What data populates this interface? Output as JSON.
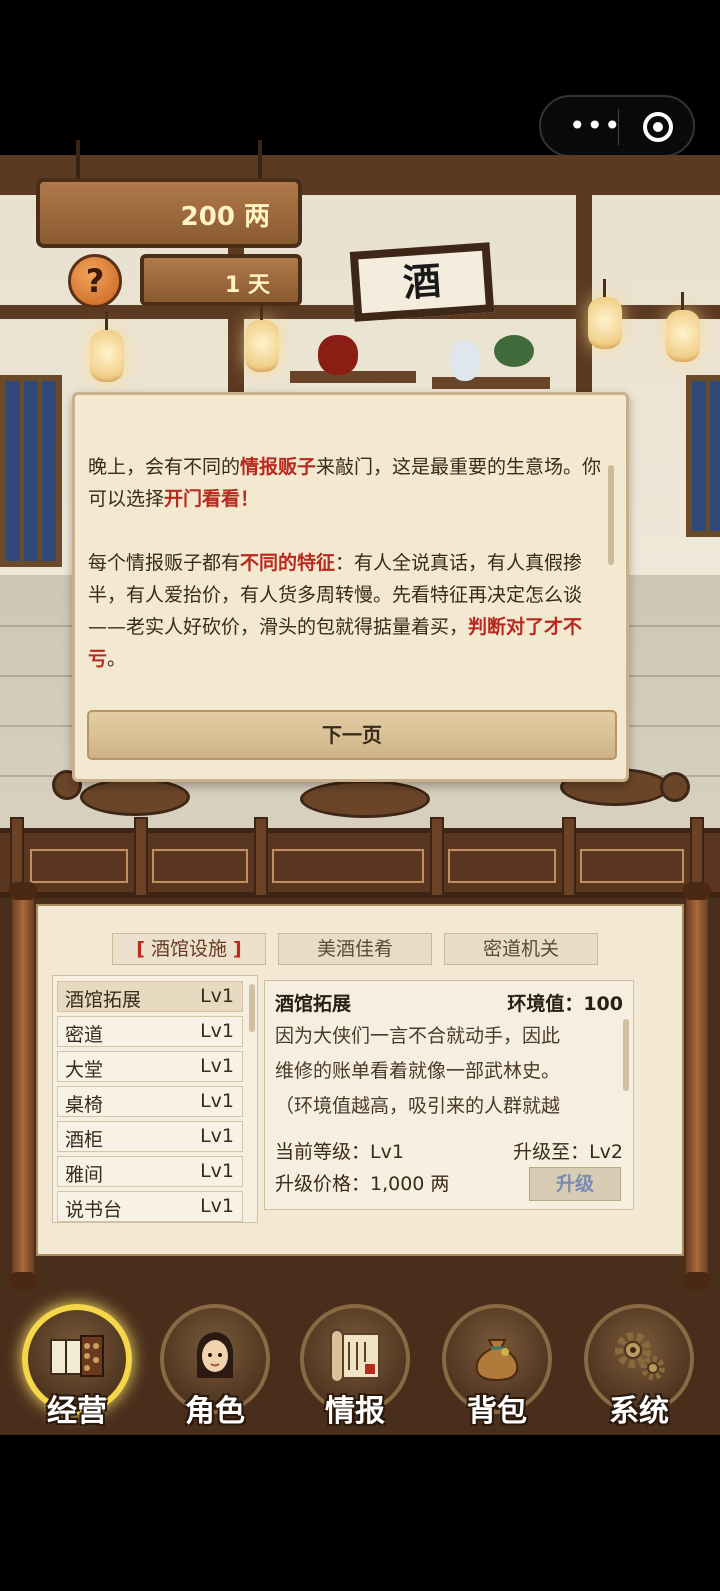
{
  "status": {
    "money": "200 两",
    "day": "1 天"
  },
  "scene": {
    "shop_sign": "酒"
  },
  "dialog": {
    "paragraph1": [
      {
        "t": "晚上，会有不同的",
        "hl": false
      },
      {
        "t": "情报贩子",
        "hl": true
      },
      {
        "t": "来敲门，这是最重要的生意场。你可以选择",
        "hl": false
      },
      {
        "t": "开门看看！",
        "hl": true
      }
    ],
    "paragraph2": [
      {
        "t": "每个情报贩子都有",
        "hl": false
      },
      {
        "t": "不同的特征",
        "hl": true
      },
      {
        "t": "：有人全说真话，有人真假掺半，有人爱抬价，有人货多周转慢。先看特征再决定怎么谈——老实人好砍价，滑头的包就得掂量着买，",
        "hl": false
      },
      {
        "t": "判断对了才不亏",
        "hl": true
      },
      {
        "t": "。",
        "hl": false
      }
    ],
    "next_label": "下一页"
  },
  "tabs": {
    "facilities_bracket_left": "[",
    "facilities": "酒馆设施",
    "facilities_bracket_right": "]",
    "food": "美酒佳肴",
    "secret": "密道机关"
  },
  "facility_list": [
    {
      "name": "酒馆拓展",
      "level": "Lv1"
    },
    {
      "name": "密道",
      "level": "Lv1"
    },
    {
      "name": "大堂",
      "level": "Lv1"
    },
    {
      "name": "桌椅",
      "level": "Lv1"
    },
    {
      "name": "酒柜",
      "level": "Lv1"
    },
    {
      "name": "雅间",
      "level": "Lv1"
    },
    {
      "name": "说书台",
      "level": "Lv1"
    }
  ],
  "detail": {
    "title": "酒馆拓展",
    "env": "环境值：100",
    "desc_line1": "因为大侠们一言不合就动手，因此",
    "desc_line2": "维修的账单看着就像一部武林史。",
    "desc_line3": "（环境值越高，吸引来的人群就越",
    "current_level": "当前等级：Lv1",
    "upgrade_to": "升级至：Lv2",
    "price": "升级价格：1,000 两",
    "upgrade_label": "升级"
  },
  "nav": [
    {
      "label": "经营",
      "icon": "ledger-abacus-icon"
    },
    {
      "label": "角色",
      "icon": "character-portrait-icon"
    },
    {
      "label": "情报",
      "icon": "scroll-document-icon"
    },
    {
      "label": "背包",
      "icon": "money-bag-icon"
    },
    {
      "label": "系统",
      "icon": "gears-icon"
    }
  ],
  "colors": {
    "highlight": "#b8291e",
    "active_nav_ring": "#f5d64a"
  }
}
